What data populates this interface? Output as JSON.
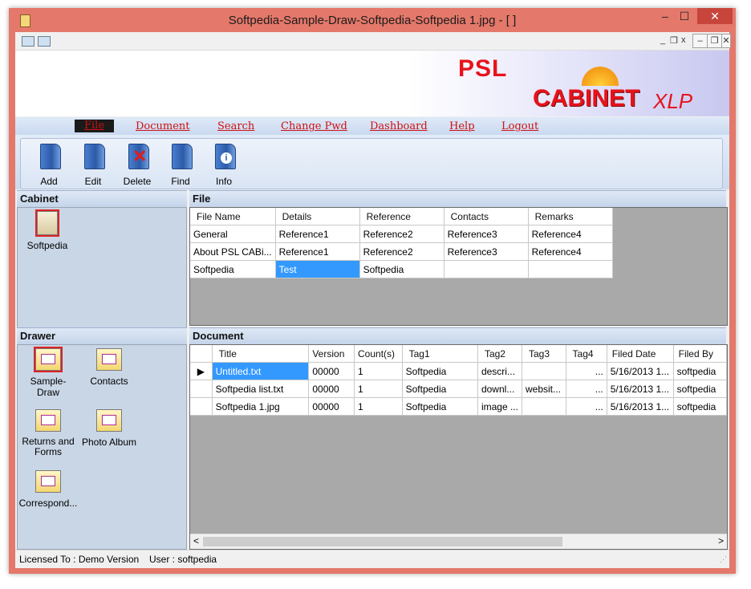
{
  "window": {
    "title": "Softpedia-Sample-Draw-Softpedia-Softpedia 1.jpg - [ ]",
    "minimize": "–",
    "maximize": "☐",
    "close": "✕"
  },
  "mdi": {
    "minimize": "_",
    "restore": "❐",
    "close": "x",
    "sq_min": "–",
    "sq_restore": "❐",
    "sq_close": "✕"
  },
  "banner": {
    "psl": "PSL",
    "cabinet": "CABINET",
    "xlp": "XLP"
  },
  "menu": {
    "file": "File",
    "document": "Document",
    "search": "Search",
    "change_pwd": "Change Pwd",
    "dashboard": "Dashboard",
    "help": "Help",
    "logout": "Logout"
  },
  "toolbar": {
    "add": "Add",
    "edit": "Edit",
    "delete": "Delete",
    "find": "Find",
    "info": "Info"
  },
  "cabinet": {
    "header": "Cabinet",
    "items": [
      "Softpedia"
    ]
  },
  "drawer": {
    "header": "Drawer",
    "items": [
      "Sample-Draw",
      "Contacts",
      "Returns and Forms",
      "Photo Album",
      "Correspond..."
    ]
  },
  "file_panel": {
    "header": "File",
    "columns": [
      "File Name",
      "Details",
      "Reference",
      "Contacts",
      "Remarks"
    ],
    "rows": [
      [
        "General",
        "Reference1",
        "Reference2",
        "Reference3",
        "Reference4"
      ],
      [
        "About PSL CABi...",
        "Reference1",
        "Reference2",
        "Reference3",
        "Reference4"
      ],
      [
        "Softpedia",
        "Test",
        "Softpedia",
        "",
        ""
      ]
    ]
  },
  "document_panel": {
    "header": "Document",
    "columns": [
      "Title",
      "Version",
      "Count(s)",
      "Tag1",
      "Tag2",
      "Tag3",
      "Tag4",
      "Filed Date",
      "Filed By"
    ],
    "rows": [
      [
        "Untitled.txt",
        "00000",
        "1",
        "Softpedia",
        "descri...",
        "",
        "...",
        "5/16/2013 1...",
        "softpedia"
      ],
      [
        "Softpedia list.txt",
        "00000",
        "1",
        "Softpedia",
        "downl...",
        "websit...",
        "...",
        "5/16/2013 1...",
        "softpedia"
      ],
      [
        "Softpedia 1.jpg",
        "00000",
        "1",
        "Softpedia",
        "image ...",
        "",
        "...",
        "5/16/2013 1...",
        "softpedia"
      ]
    ],
    "ellipsis": "...",
    "row_pointer": "▶"
  },
  "scroll": {
    "left": "<",
    "right": ">"
  },
  "status": {
    "license": "Licensed To : Demo Version",
    "user": "User : softpedia"
  },
  "colors": {
    "frame": "#e4786a",
    "menu_text": "#cc1111",
    "selection": "#3399ff",
    "banner_red": "#e8121b"
  }
}
